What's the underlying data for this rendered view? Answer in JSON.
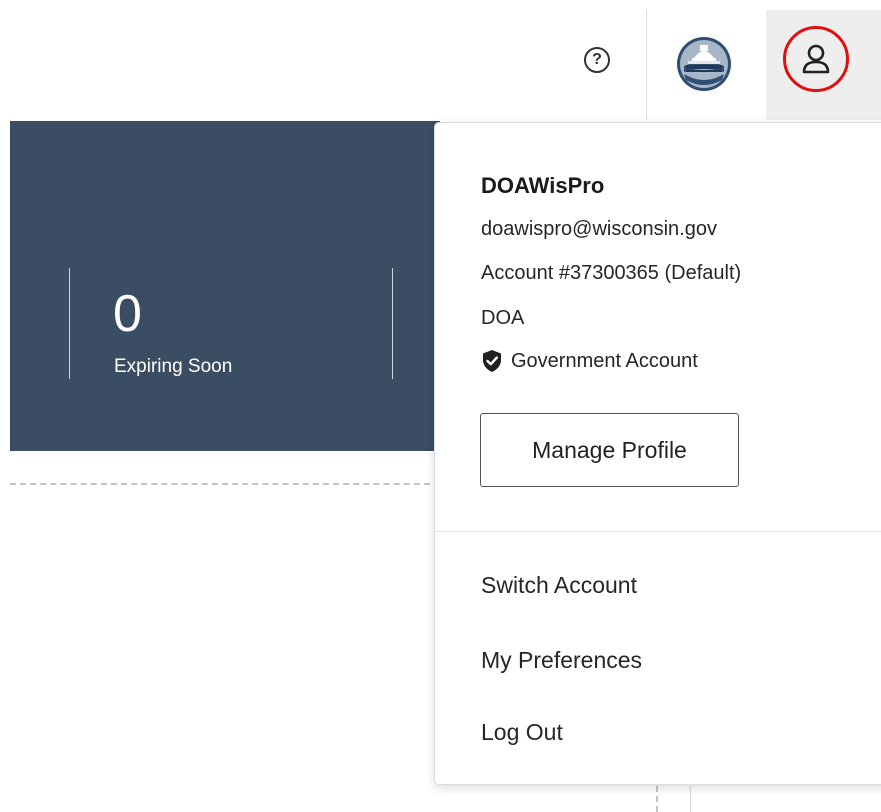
{
  "header": {
    "help_symbol": "?",
    "agency_seal_icon": "department-of-administration-seal",
    "profile_icon": "user-icon",
    "profile_highlight_color": "#e01010"
  },
  "dashboard": {
    "panel_color": "#3a4d63",
    "stat": {
      "value": "0",
      "label": "Expiring Soon"
    }
  },
  "profile_menu": {
    "user_name": "DOAWisPro",
    "email": "doawispro@wisconsin.gov",
    "account": "Account #37300365 (Default)",
    "organization": "DOA",
    "account_type": "Government Account",
    "manage_profile_label": "Manage Profile",
    "items": [
      {
        "label": "Switch Account"
      },
      {
        "label": "My Preferences"
      },
      {
        "label": "Log Out"
      }
    ]
  }
}
